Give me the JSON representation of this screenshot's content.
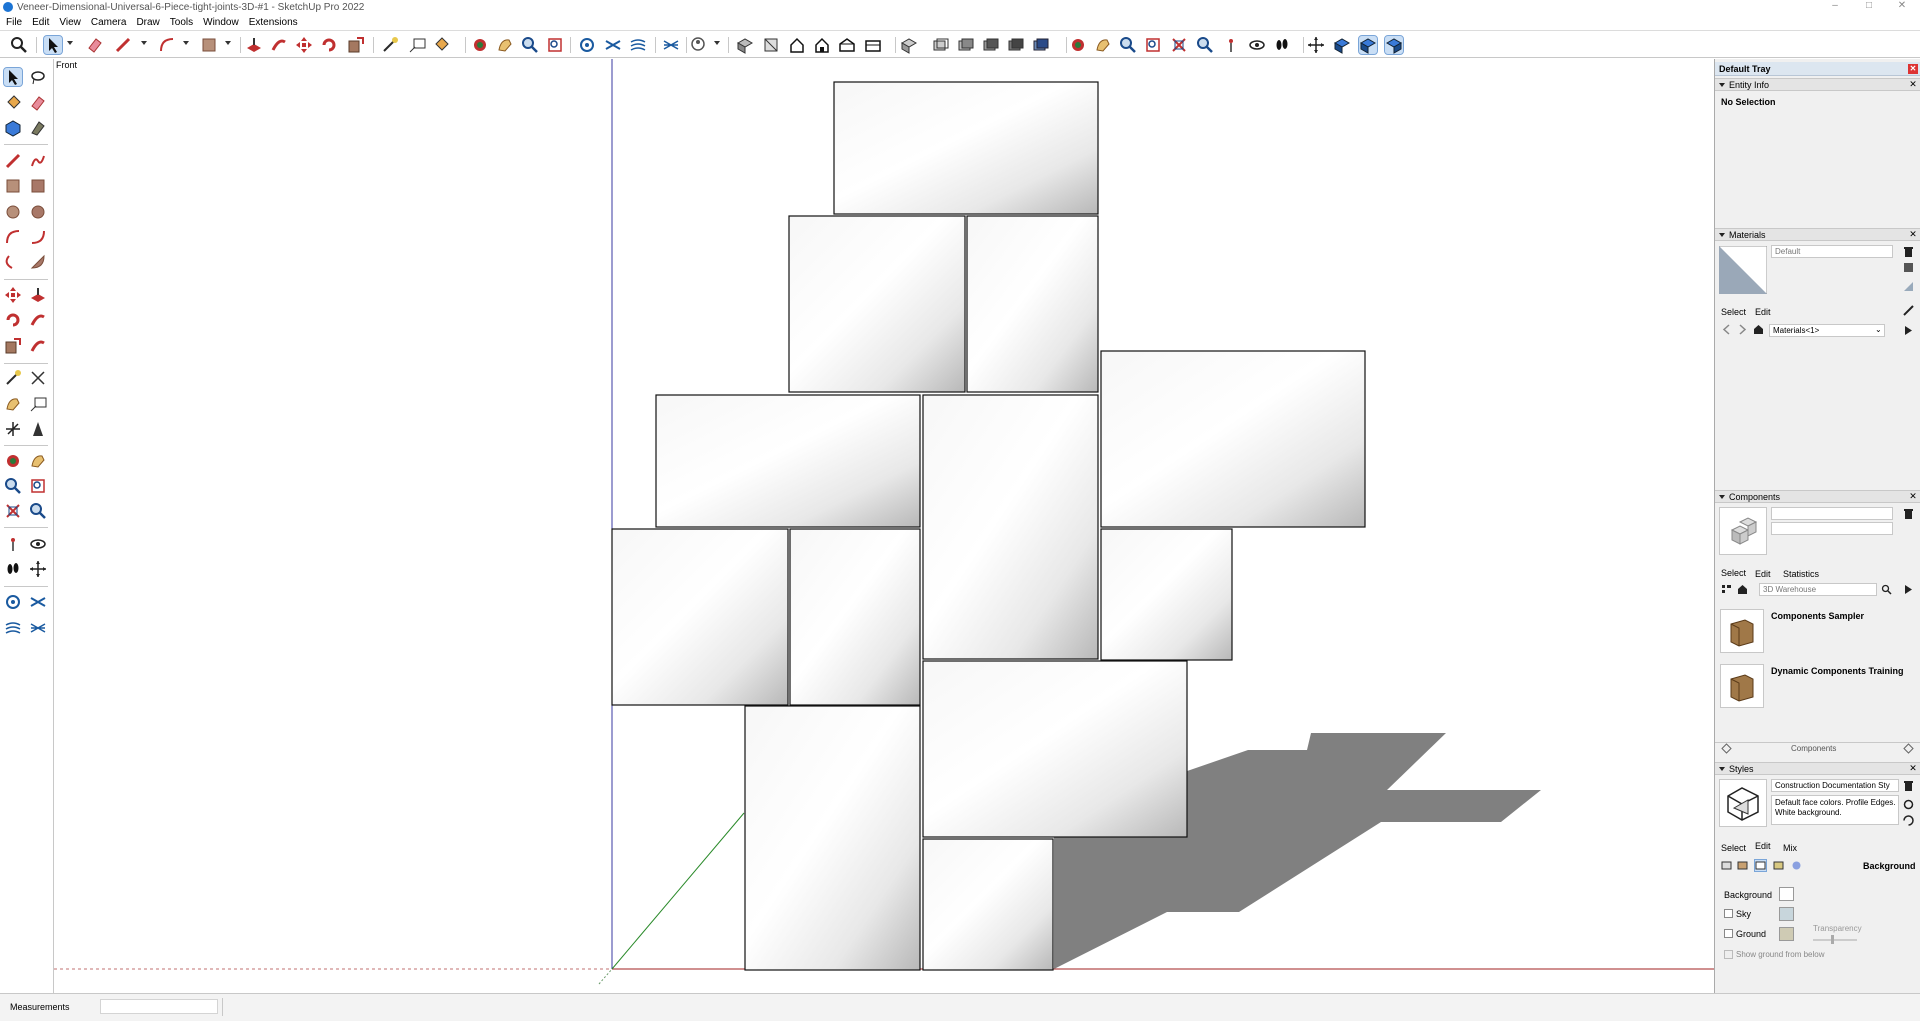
{
  "window": {
    "title": "Veneer-Dimensional-Universal-6-Piece-tight-joints-3D-#1 - SketchUp Pro 2022",
    "minimize_glyph": "–",
    "maximize_glyph": "□",
    "close_glyph": "✕"
  },
  "menu": [
    "File",
    "Edit",
    "View",
    "Camera",
    "Draw",
    "Tools",
    "Window",
    "Extensions"
  ],
  "toolbar": {
    "icons": [
      "search-icon",
      "select-arrow-icon",
      "eraser-icon",
      "pencil-icon",
      "rectangle-icon",
      "paint-bucket-icon",
      "push-pull-icon",
      "follow-me-icon",
      "rotate-icon",
      "move-icon",
      "scale-icon",
      "tape-measure-icon",
      "text-icon",
      "paint-icon",
      "paint-sample-icon",
      "zoom-icon",
      "zoom-extents-icon",
      "sandbox-icon",
      "sandbox-smoove-icon",
      "sandbox-stamp-icon",
      "sandbox-drape-icon",
      "warehouse-icon",
      "views-icon",
      "iso-view-icon",
      "top-view-icon",
      "front-view-icon",
      "right-view-icon",
      "back-view-icon",
      "left-view-icon",
      "xray-icon",
      "wireframe-icon",
      "hidden-line-icon",
      "shaded-icon",
      "textured-icon",
      "monochrome-icon",
      "orbit-icon",
      "pan-icon",
      "zoom-window-icon",
      "zoom-extents-2-icon",
      "previous-view-icon",
      "position-camera-icon",
      "look-around-icon",
      "walk-icon",
      "section-plane-icon",
      "display-section-icon",
      "section-cuts-icon",
      "section-fill-icon"
    ],
    "accent": "#1c74d4"
  },
  "viewport": {
    "scene_label": "Front",
    "face_color": "#f4f4f4",
    "shadow_color": "#808080"
  },
  "status": {
    "measurements_label": "Measurements",
    "measurements_value": ""
  },
  "tray": {
    "title": "Default Tray",
    "entity_info": {
      "header": "Entity Info",
      "selection": "No Selection"
    },
    "materials": {
      "header": "Materials",
      "current": "Default",
      "tab_select": "Select",
      "tab_edit": "Edit",
      "library": "Materials<1>"
    },
    "components": {
      "header": "Components",
      "tab_select": "Select",
      "tab_edit": "Edit",
      "tab_statistics": "Statistics",
      "search_placeholder": "3D Warehouse",
      "items": [
        {
          "name": "Components Sampler"
        },
        {
          "name": "Dynamic Components Training"
        }
      ],
      "footer": "Components"
    },
    "styles": {
      "header": "Styles",
      "name": "Construction Documentation Sty",
      "description": "Default face colors. Profile Edges. White background.",
      "tab_select": "Select",
      "tab_edit": "Edit",
      "tab_mix": "Mix",
      "section": "Background",
      "background_label": "Background",
      "sky_label": "Sky",
      "ground_label": "Ground",
      "transparency_label": "Transparency",
      "show_ground_below": "Show ground from below",
      "background_color": "#ffffff",
      "sky_color": "#c8d6dc",
      "ground_color": "#cfcbb4"
    }
  }
}
